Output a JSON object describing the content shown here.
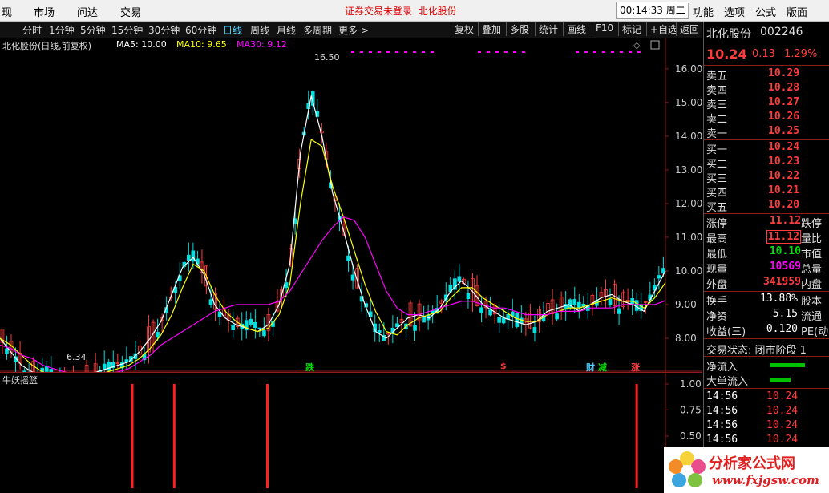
{
  "menu": {
    "items": [
      "现",
      "市场",
      "问达",
      "交易"
    ],
    "right_items": [
      "功能",
      "选项",
      "公式",
      "版面"
    ],
    "notice": "证券交易未登录",
    "stock_link": "北化股份",
    "clock": "00:14:33 周二"
  },
  "periods": [
    "分时",
    "1分钟",
    "5分钟",
    "15分钟",
    "30分钟",
    "60分钟",
    "日线",
    "周线",
    "月线",
    "多周期",
    "更多 >"
  ],
  "active_period": "日线",
  "tools": [
    "复权",
    "叠加",
    "多股",
    "统计",
    "画线",
    "F10",
    "标记",
    "+自选",
    "返回"
  ],
  "main_legend": {
    "title": "北化股份(日线,前复权)",
    "ma5": "MA5: 10.00",
    "ma10": "MA10: 9.65",
    "ma30": "MA30: 9.12"
  },
  "sub_legend": {
    "title": "牛妖摇篮"
  },
  "signals": {
    "die": "跌",
    "s": "$",
    "cai": "财",
    "jian": "减",
    "zhang": "涨"
  },
  "annotations": {
    "high": "16.50",
    "low": "6.34"
  },
  "chart_data": {
    "type": "line",
    "y_ticks": [
      "16.00",
      "15.00",
      "14.00",
      "13.00",
      "12.00",
      "11.00",
      "10.00",
      "9.00",
      "8.00"
    ],
    "ylim": [
      7.0,
      16.9
    ],
    "sub_ticks": [
      "1.00",
      "0.75",
      "0.50",
      "0.25"
    ],
    "sub_ylim": [
      0,
      1.1
    ],
    "series": [
      {
        "name": "MA5",
        "color": "#ffffff",
        "values": [
          8.0,
          7.6,
          7.2,
          7.0,
          6.9,
          6.8,
          6.7,
          6.7,
          6.8,
          7.0,
          7.1,
          7.2,
          7.3,
          7.6,
          8.0,
          8.5,
          9.3,
          10.1,
          10.4,
          9.9,
          9.0,
          8.6,
          8.4,
          8.3,
          8.2,
          8.4,
          9.0,
          10.2,
          13.5,
          15.2,
          14.0,
          12.3,
          11.2,
          10.0,
          9.0,
          8.2,
          8.0,
          8.3,
          8.6,
          8.7,
          8.6,
          8.9,
          9.4,
          9.7,
          9.4,
          9.0,
          8.8,
          8.6,
          8.5,
          8.4,
          8.5,
          8.8,
          8.9,
          9.0,
          8.8,
          9.0,
          9.2,
          9.3,
          9.1,
          9.0,
          8.8,
          9.4,
          10.0
        ]
      },
      {
        "name": "MA10",
        "color": "#ffff00",
        "values": [
          8.0,
          7.8,
          7.5,
          7.2,
          7.0,
          6.9,
          6.8,
          6.7,
          6.8,
          6.9,
          7.0,
          7.1,
          7.2,
          7.4,
          7.7,
          8.1,
          8.7,
          9.5,
          10.2,
          10.0,
          9.3,
          8.8,
          8.5,
          8.3,
          8.2,
          8.3,
          8.7,
          9.6,
          12.0,
          13.9,
          13.7,
          12.5,
          11.6,
          10.6,
          9.6,
          8.8,
          8.2,
          8.1,
          8.4,
          8.6,
          8.7,
          8.8,
          9.2,
          9.5,
          9.5,
          9.2,
          9.0,
          8.8,
          8.6,
          8.5,
          8.5,
          8.7,
          8.8,
          8.9,
          8.9,
          9.0,
          9.1,
          9.2,
          9.1,
          9.1,
          8.9,
          9.2,
          9.65
        ]
      },
      {
        "name": "MA30",
        "color": "#ff00ff",
        "values": [
          7.8,
          7.7,
          7.5,
          7.4,
          7.2,
          7.1,
          7.0,
          6.95,
          6.9,
          6.9,
          6.95,
          7.0,
          7.1,
          7.3,
          7.5,
          7.8,
          8.0,
          8.2,
          8.4,
          8.6,
          8.8,
          8.9,
          9.0,
          9.0,
          9.0,
          9.0,
          9.1,
          9.4,
          9.9,
          10.4,
          10.9,
          11.3,
          11.6,
          11.5,
          11.0,
          10.2,
          9.4,
          8.9,
          8.7,
          8.7,
          8.8,
          8.9,
          9.0,
          9.1,
          9.1,
          9.0,
          8.9,
          8.9,
          8.8,
          8.7,
          8.7,
          8.7,
          8.8,
          8.8,
          8.8,
          8.9,
          8.9,
          8.9,
          9.0,
          9.0,
          9.0,
          9.0,
          9.12
        ]
      }
    ],
    "signal_bars": [
      {
        "x": 0.197,
        "value": 1.0
      },
      {
        "x": 0.26,
        "value": 1.0
      },
      {
        "x": 0.4,
        "value": 1.0
      },
      {
        "x": 0.955,
        "value": 1.0
      }
    ]
  },
  "quote": {
    "name": "北化股份",
    "code": "002246",
    "price": "10.24",
    "change": "0.13",
    "pct": "1.29%",
    "asks": [
      {
        "l": "卖五",
        "p": "10.29"
      },
      {
        "l": "卖四",
        "p": "10.28"
      },
      {
        "l": "卖三",
        "p": "10.27"
      },
      {
        "l": "卖二",
        "p": "10.26"
      },
      {
        "l": "卖一",
        "p": "10.25"
      }
    ],
    "bids": [
      {
        "l": "买一",
        "p": "10.24"
      },
      {
        "l": "买二",
        "p": "10.23"
      },
      {
        "l": "买三",
        "p": "10.22"
      },
      {
        "l": "买四",
        "p": "10.21"
      },
      {
        "l": "买五",
        "p": "10.20"
      }
    ],
    "stats": [
      {
        "l": "涨停",
        "v": "11.12",
        "r": "跌停",
        "c": "red"
      },
      {
        "l": "最高",
        "v": "11.12",
        "r": "量比",
        "c": "red"
      },
      {
        "l": "最低",
        "v": "10.10",
        "r": "市值",
        "c": "green"
      },
      {
        "l": "现量",
        "v": "10569",
        "r": "总量",
        "c": "magenta"
      },
      {
        "l": "外盘",
        "v": "341959",
        "r": "内盘",
        "c": "red"
      }
    ],
    "stats2": [
      {
        "l": "换手",
        "v": "13.88%",
        "r": "股本"
      },
      {
        "l": "净资",
        "v": "5.15",
        "r": "流通"
      },
      {
        "l": "收益(三)",
        "v": "0.120",
        "r": "PE(动)"
      }
    ],
    "status_label": "交易状态: 闭市阶段 1",
    "flows": [
      {
        "l": "净流入",
        "w": 44
      },
      {
        "l": "大单流入",
        "w": 26
      }
    ],
    "ticks": [
      {
        "t": "14:56",
        "p": "10.24"
      },
      {
        "t": "14:56",
        "p": "10.24"
      },
      {
        "t": "14:56",
        "p": "10.24"
      },
      {
        "t": "14:56",
        "p": "10.24"
      }
    ]
  },
  "watermark": {
    "title": "分析家公式网",
    "url": "www.fxjgsw.com"
  },
  "colors": {
    "up": "#ff3c3c",
    "down": "#00e0e0",
    "signal": "#ff2020"
  }
}
